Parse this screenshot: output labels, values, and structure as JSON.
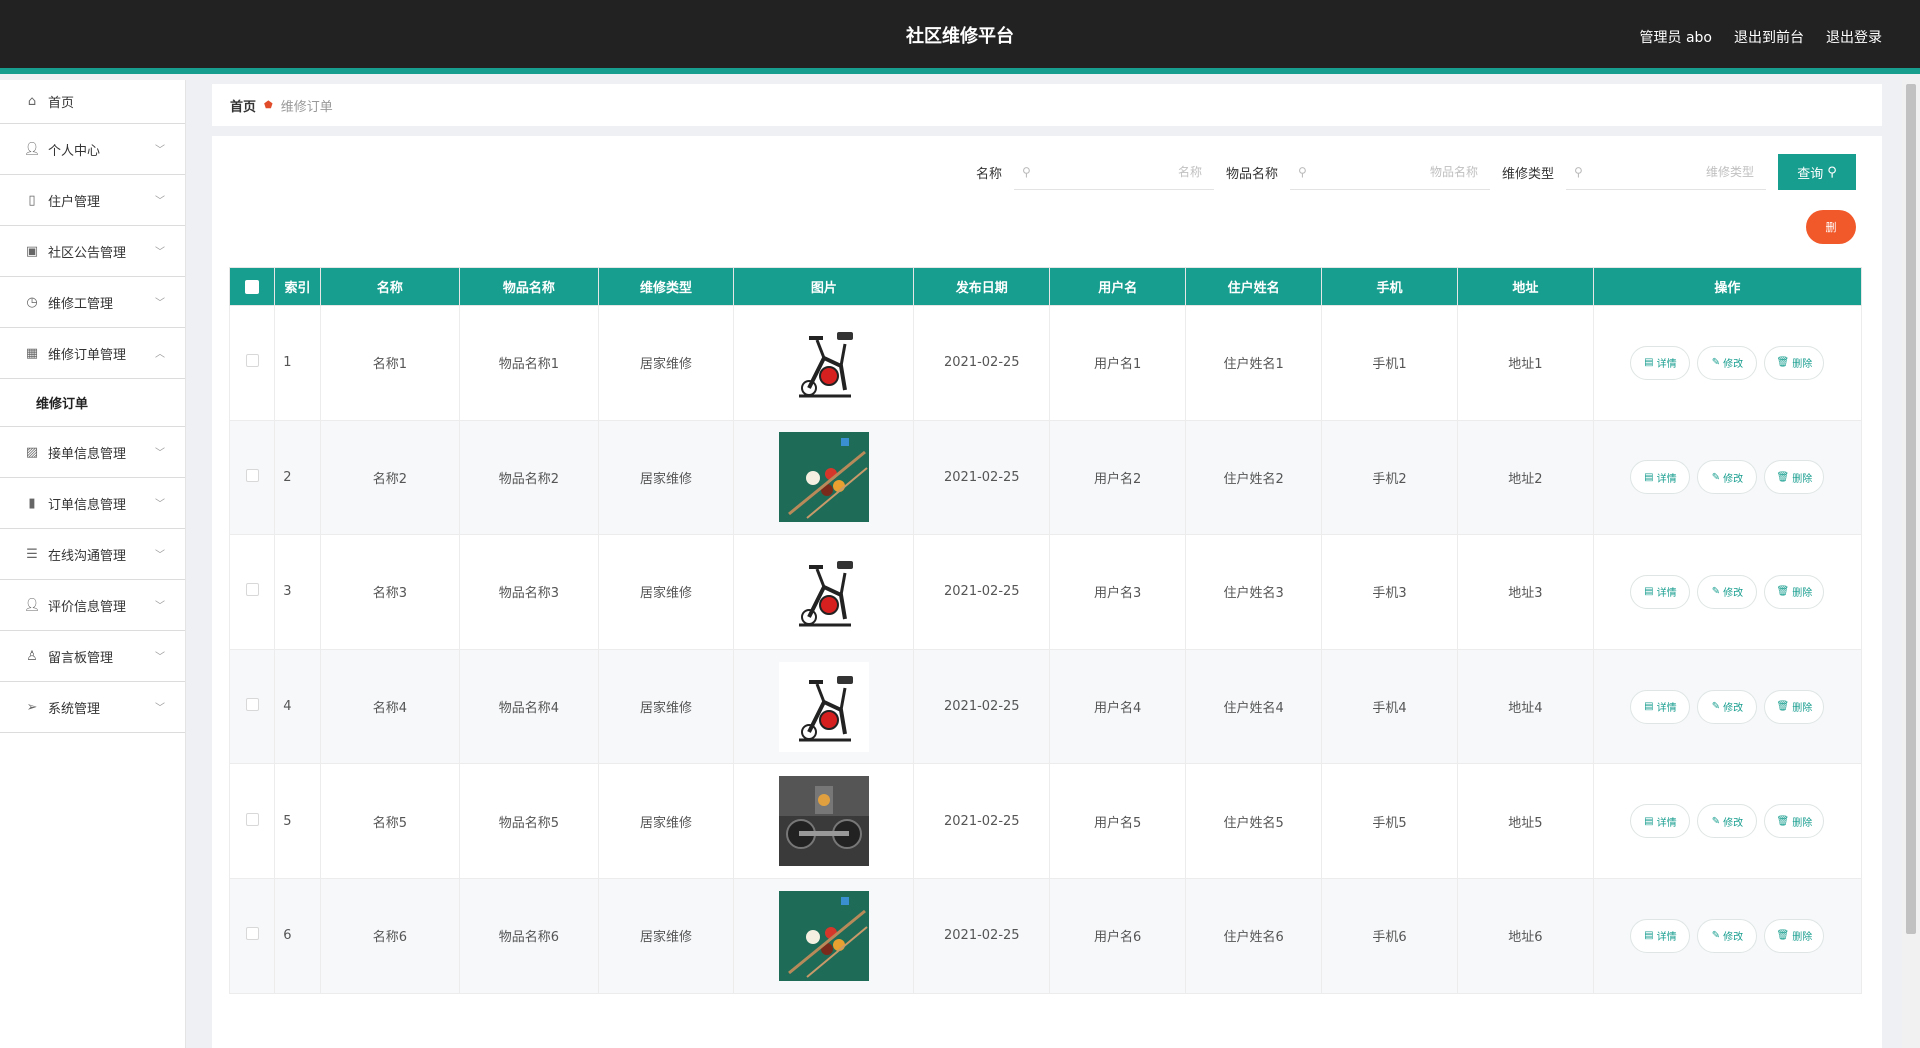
{
  "header": {
    "title": "社区维修平台",
    "admin_label": "管理员 abo",
    "frontend_link": "退出到前台",
    "logout_link": "退出登录"
  },
  "sidebar": {
    "items": [
      {
        "label": "首页",
        "icon": "home-icon"
      },
      {
        "label": "个人中心",
        "icon": "user-icon",
        "has_children": true
      },
      {
        "label": "住户管理",
        "icon": "phone-icon",
        "has_children": true
      },
      {
        "label": "社区公告管理",
        "icon": "board-icon",
        "has_children": true
      },
      {
        "label": "维修工管理",
        "icon": "clock-icon",
        "has_children": true
      },
      {
        "label": "维修订单管理",
        "icon": "grid-icon",
        "has_children": true,
        "expanded": true
      }
    ],
    "subitem": {
      "label": "维修订单"
    },
    "items_after": [
      {
        "label": "接单信息管理",
        "icon": "image-icon"
      },
      {
        "label": "订单信息管理",
        "icon": "chart-icon"
      },
      {
        "label": "在线沟通管理",
        "icon": "list-icon"
      },
      {
        "label": "评价信息管理",
        "icon": "user-icon"
      },
      {
        "label": "留言板管理",
        "icon": "person-icon"
      },
      {
        "label": "系统管理",
        "icon": "send-icon"
      }
    ]
  },
  "breadcrumb": {
    "home": "首页",
    "current": "维修订单"
  },
  "search": {
    "name_label": "名称",
    "name_placeholder": "名称",
    "item_label": "物品名称",
    "item_placeholder": "物品名称",
    "type_label": "维修类型",
    "type_placeholder": "维修类型",
    "query_button": "查询"
  },
  "delete_button_label": "删",
  "table": {
    "headers": [
      "索引",
      "名称",
      "物品名称",
      "维修类型",
      "图片",
      "发布日期",
      "用户名",
      "住户姓名",
      "手机",
      "地址",
      "操作"
    ],
    "action_labels": {
      "detail": "详情",
      "edit": "修改",
      "delete": "删除"
    },
    "rows": [
      {
        "index": "1",
        "name": "名称1",
        "item": "物品名称1",
        "type": "居家维修",
        "image": "exercise-bike-image",
        "date": "2021-02-25",
        "username": "用户名1",
        "resident": "住户姓名1",
        "phone": "手机1",
        "address": "地址1"
      },
      {
        "index": "2",
        "name": "名称2",
        "item": "物品名称2",
        "type": "居家维修",
        "image": "billiards-image",
        "date": "2021-02-25",
        "username": "用户名2",
        "resident": "住户姓名2",
        "phone": "手机2",
        "address": "地址2"
      },
      {
        "index": "3",
        "name": "名称3",
        "item": "物品名称3",
        "type": "居家维修",
        "image": "exercise-bike-image",
        "date": "2021-02-25",
        "username": "用户名3",
        "resident": "住户姓名3",
        "phone": "手机3",
        "address": "地址3"
      },
      {
        "index": "4",
        "name": "名称4",
        "item": "物品名称4",
        "type": "居家维修",
        "image": "exercise-bike-image",
        "date": "2021-02-25",
        "username": "用户名4",
        "resident": "住户姓名4",
        "phone": "手机4",
        "address": "地址4"
      },
      {
        "index": "5",
        "name": "名称5",
        "item": "物品名称5",
        "type": "居家维修",
        "image": "gym-weights-image",
        "date": "2021-02-25",
        "username": "用户名5",
        "resident": "住户姓名5",
        "phone": "手机5",
        "address": "地址5"
      },
      {
        "index": "6",
        "name": "名称6",
        "item": "物品名称6",
        "type": "居家维修",
        "image": "billiards-image",
        "date": "2021-02-25",
        "username": "用户名6",
        "resident": "住户姓名6",
        "phone": "手机6",
        "address": "地址6"
      }
    ]
  },
  "colors": {
    "accent": "#189e8f",
    "topbar": "#222222",
    "danger": "#f1592a"
  }
}
